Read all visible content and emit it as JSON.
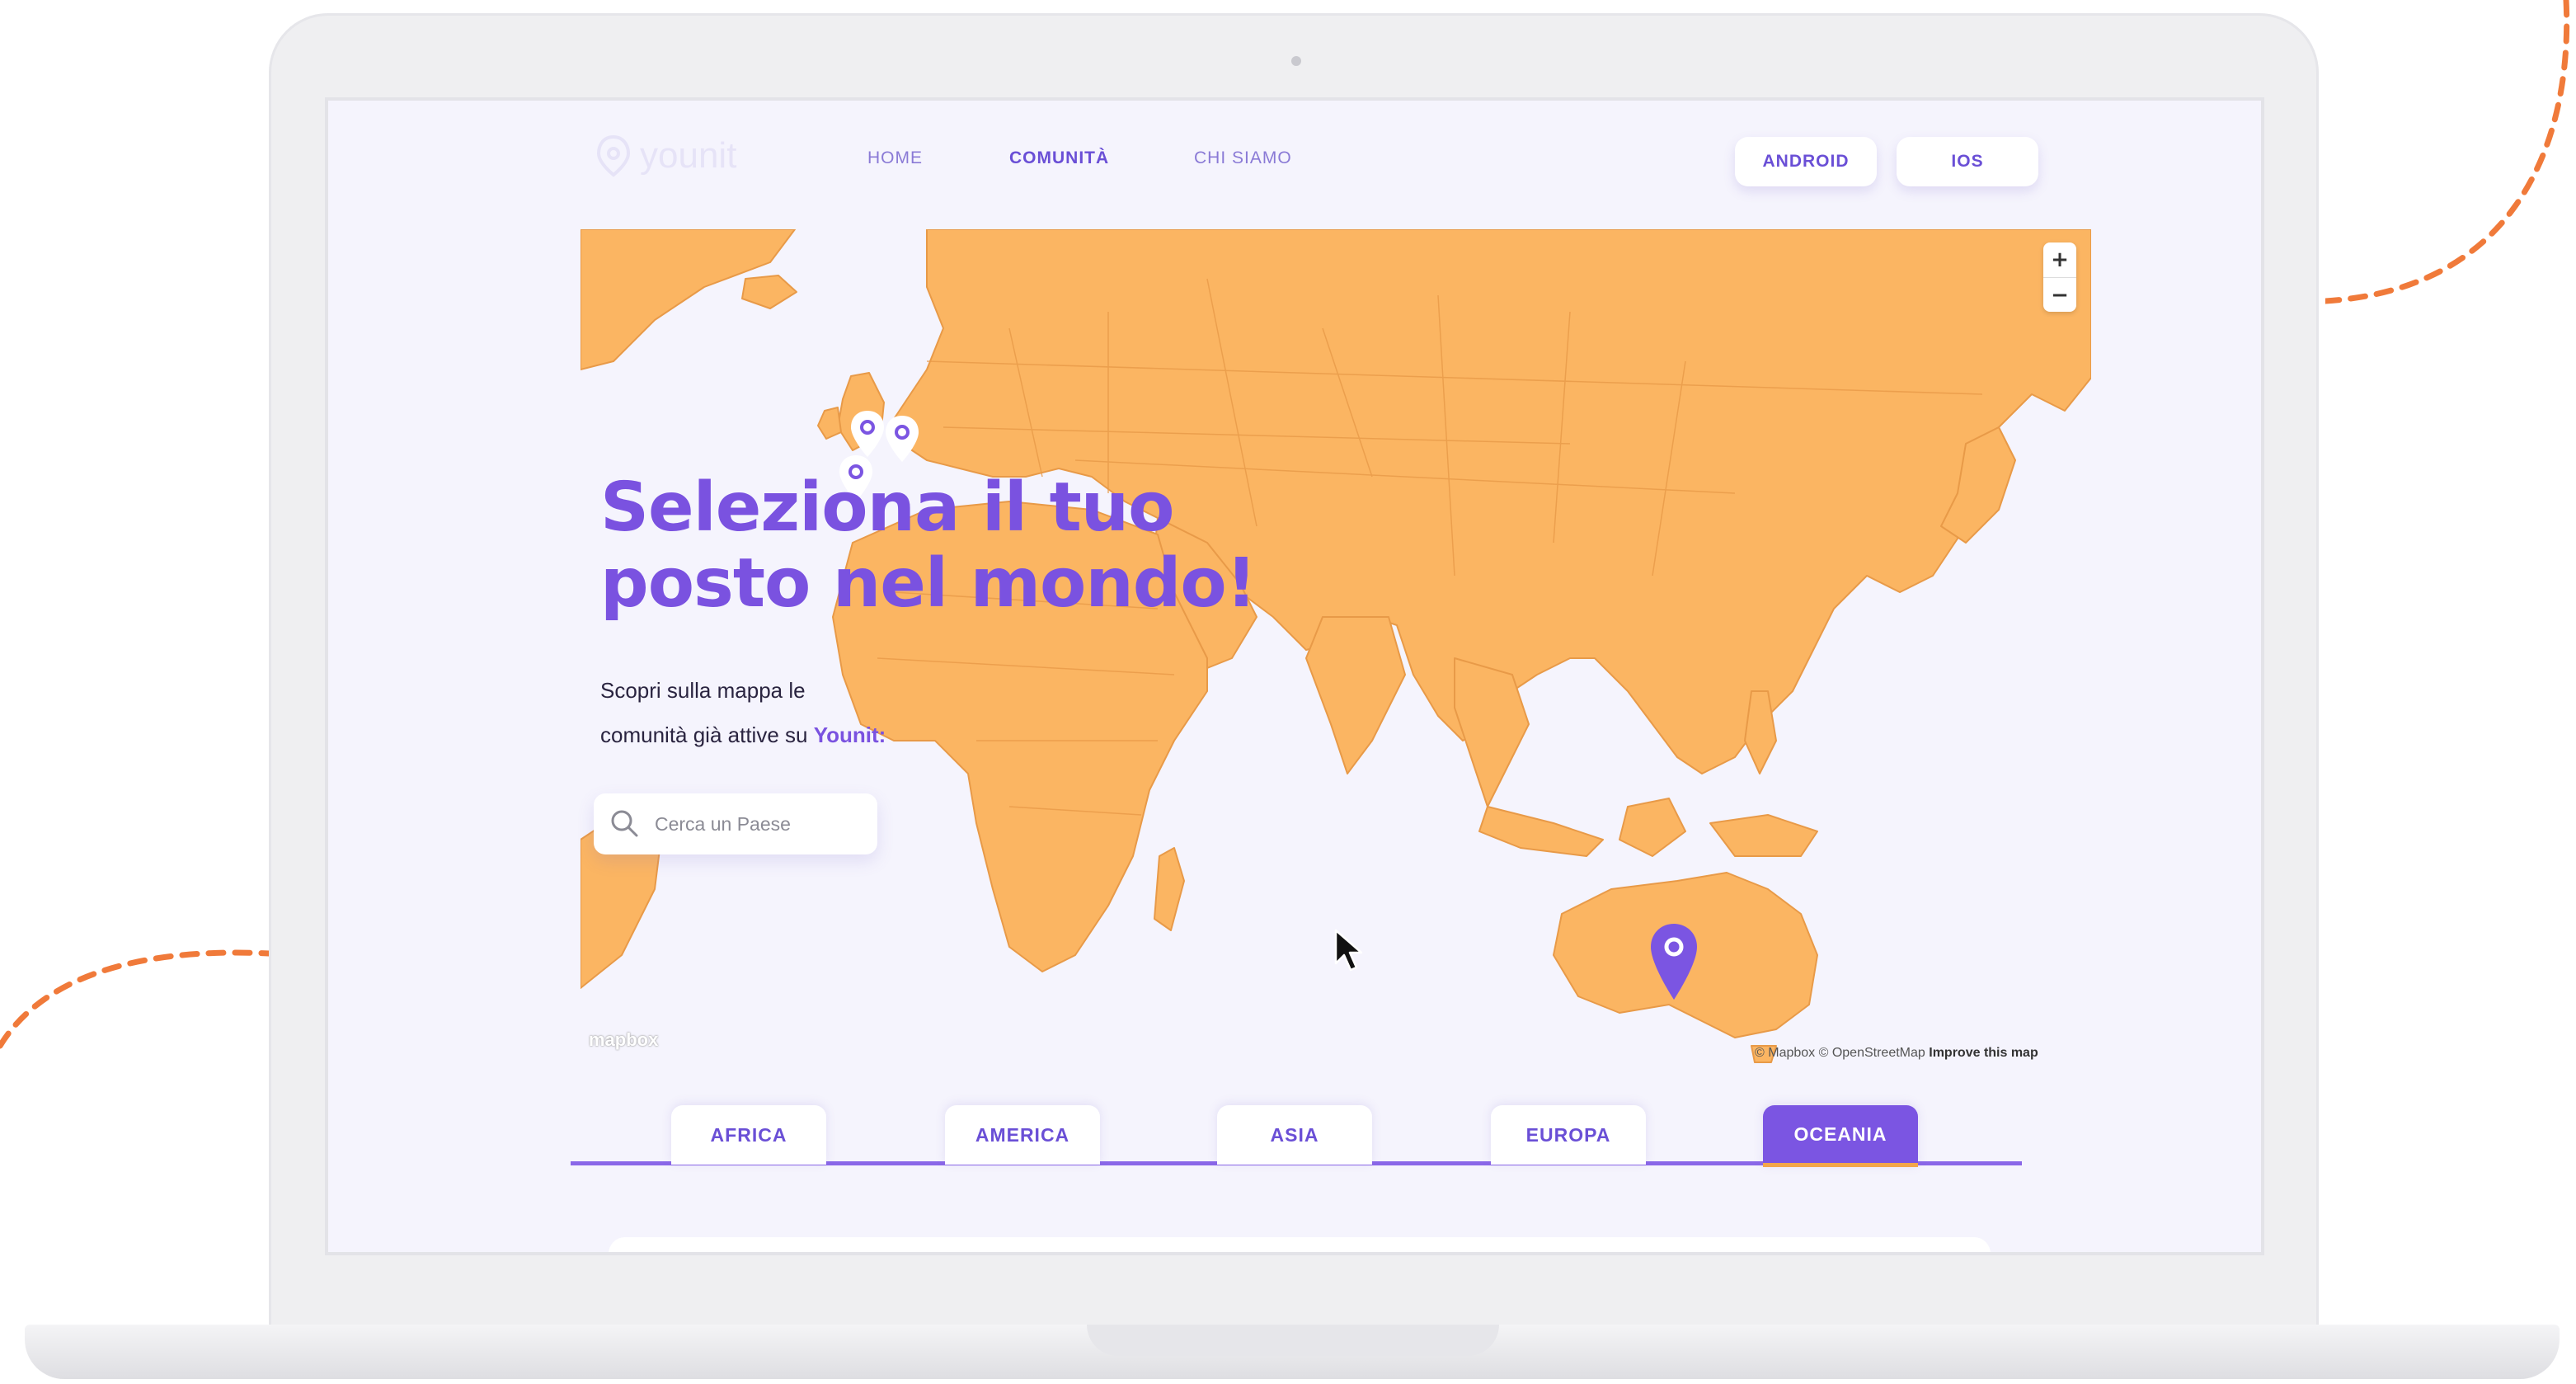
{
  "app": {
    "logo_text": "younit"
  },
  "nav": {
    "items": [
      {
        "label": "HOME",
        "active": false
      },
      {
        "label": "COMUNITÀ",
        "active": true
      },
      {
        "label": "CHI SIAMO",
        "active": false
      }
    ]
  },
  "store_buttons": {
    "android": "ANDROID",
    "ios": "IOS"
  },
  "hero": {
    "headline_line1": "Seleziona il tuo",
    "headline_line2": "posto nel mondo!",
    "subtext_line1": "Scopri sulla mappa le",
    "subtext_line2": "comunità già attive su",
    "brand": "Younit:"
  },
  "search": {
    "placeholder": "Cerca un Paese",
    "value": ""
  },
  "map": {
    "zoom_in": "+",
    "zoom_out": "−",
    "provider_logo": "mapbox",
    "attribution": "© Mapbox © OpenStreetMap",
    "improve_link": "Improve this map",
    "land_color": "#fbb562",
    "border_color": "#e89a48",
    "pin_color": "#7b55e2"
  },
  "tabs": {
    "items": [
      {
        "label": "AFRICA",
        "active": false
      },
      {
        "label": "AMERICA",
        "active": false
      },
      {
        "label": "ASIA",
        "active": false
      },
      {
        "label": "EUROPA",
        "active": false
      },
      {
        "label": "OCEANIA",
        "active": true
      }
    ]
  },
  "colors": {
    "accent": "#7b55e2",
    "highlight": "#f3a64a",
    "decor_dash": "#f07a3a"
  },
  "icons": [
    "search-icon",
    "map-pin-icon",
    "cursor-arrow-icon",
    "plus-icon",
    "minus-icon"
  ]
}
